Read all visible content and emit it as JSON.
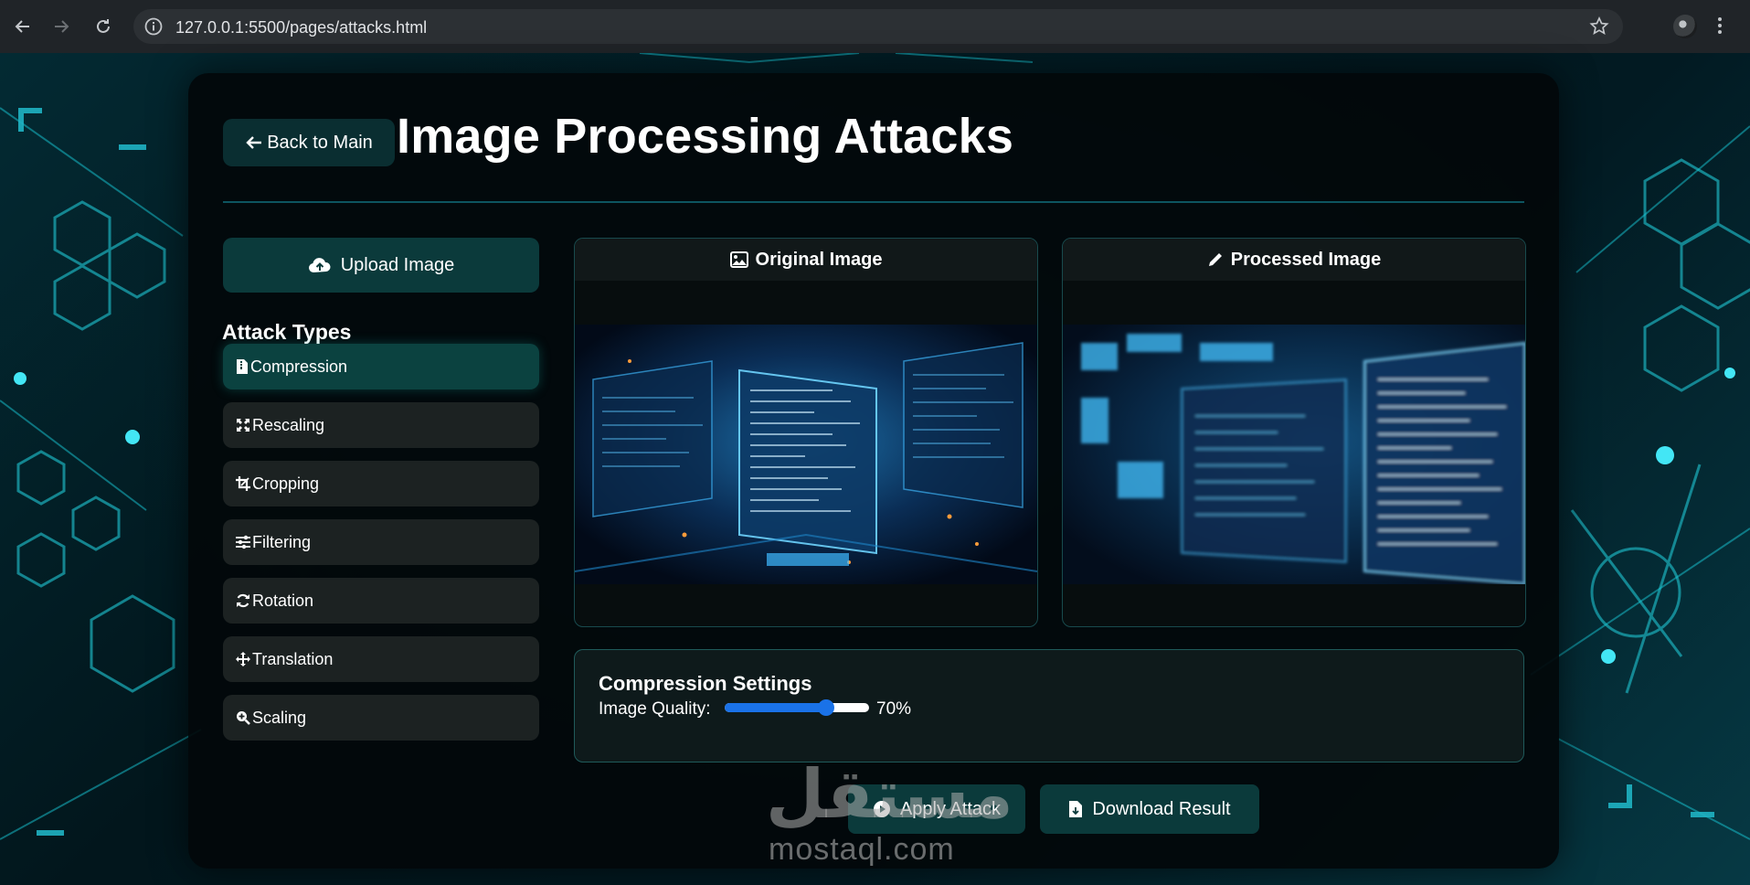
{
  "browser": {
    "url": "127.0.0.1:5500/pages/attacks.html"
  },
  "header": {
    "back_label": "Back to Main",
    "title": "Image Processing Attacks"
  },
  "sidebar": {
    "upload_label": "Upload Image",
    "attack_heading": "Attack Types",
    "attacks": [
      {
        "label": "Compression",
        "icon": "file-zip-icon",
        "active": true
      },
      {
        "label": "Rescaling",
        "icon": "expand-arrows-icon",
        "active": false
      },
      {
        "label": "Cropping",
        "icon": "crop-icon",
        "active": false
      },
      {
        "label": "Filtering",
        "icon": "sliders-icon",
        "active": false
      },
      {
        "label": "Rotation",
        "icon": "rotate-icon",
        "active": false
      },
      {
        "label": "Translation",
        "icon": "move-arrows-icon",
        "active": false
      },
      {
        "label": "Scaling",
        "icon": "zoom-in-icon",
        "active": false
      }
    ]
  },
  "panels": {
    "original_title": "Original Image",
    "processed_title": "Processed Image"
  },
  "settings": {
    "title": "Compression Settings",
    "quality_label": "Image Quality:",
    "quality_value": 70,
    "quality_text": "70%"
  },
  "actions": {
    "apply_label": "Apply Attack",
    "download_label": "Download Result"
  },
  "watermark": {
    "arabic": "مستقل",
    "latin": "mostaql.com"
  },
  "colors": {
    "accent": "#0b3a3b",
    "slider": "#1a72e8",
    "card": "#02080a"
  }
}
